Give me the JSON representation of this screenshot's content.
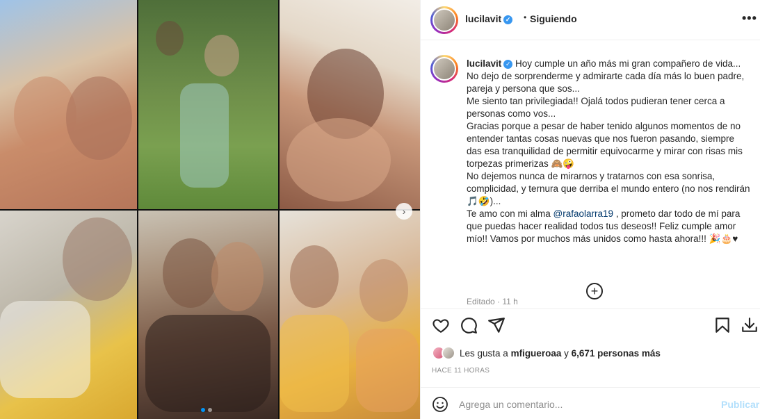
{
  "post": {
    "username": "lucilavit",
    "follow_status": "Siguiendo",
    "separator": "•"
  },
  "caption": {
    "username": "lucilavit",
    "lines": [
      "Hoy cumple un año más mi gran compañero de vida...",
      "No dejo de sorprenderme y admirarte cada día más lo buen padre, pareja y persona que sos...",
      "Me siento tan privilegiada!! Ojalá todos pudieran tener cerca a personas como vos...",
      "Gracias porque a pesar de haber tenido algunos momentos de no entender tantas cosas nuevas que nos fueron pasando, siempre das esa tranquilidad de permitir equivocarme y mirar con risas mis torpezas primerizas 🙈🤪",
      "No dejemos nunca de mirarnos y tratarnos con esa sonrisa, complicidad, y ternura que derriba el mundo entero (no nos rendirán 🎵🤣)..."
    ],
    "last_before_mention": "Te amo con mi alma ",
    "mention": "@rafaolarra19",
    "last_after_mention": " , prometo dar todo de mí para que puedas hacer realidad todos tus deseos!! Feliz cumple amor mío!! Vamos por muchos más unidos como hasta ahora!!! 🎉🎂♥",
    "edited": "Editado · 11 h"
  },
  "actions": {
    "like_icon": "heart-icon",
    "comment_icon": "comment-icon",
    "share_icon": "share-icon",
    "save_icon": "bookmark-icon",
    "download_icon": "download-icon"
  },
  "likes": {
    "prefix": "Les gusta a ",
    "user": "mfigueroaa",
    "middle": " y ",
    "count": "6,671 personas más"
  },
  "time_ago": "HACE 11 HORAS",
  "comment": {
    "placeholder": "Agrega un comentario...",
    "publish_label": "Publicar"
  },
  "carousel": {
    "next_label": "›",
    "slide_count": 2,
    "active_slide": 1
  },
  "colors": {
    "link": "#00376b",
    "publish_disabled": "#b2dffc",
    "verified": "#3897f0",
    "muted": "#8e8e8e"
  }
}
